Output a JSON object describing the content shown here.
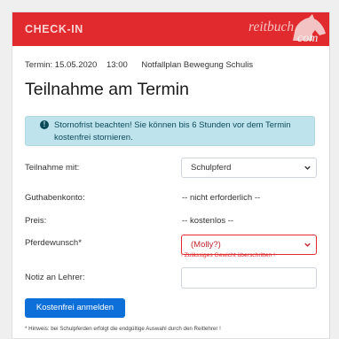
{
  "header": {
    "title": "CHECK-IN",
    "logo_text": "reitbuch",
    "logo_suffix": "com",
    "logo_icon": "horse-head-icon",
    "accent_color": "#e02a2e"
  },
  "appointment": {
    "date_text": "Termin: 15.05.2020",
    "time": "13:00",
    "name": "Notfallplan Bewegung Schulis"
  },
  "page_title": "Teilnahme am Termin",
  "alert": {
    "icon": "exclamation-circle-icon",
    "text": "Stornofrist beachten! Sie können bis 6 Stunden vor dem Termin kostenfrei stornieren."
  },
  "form": {
    "participation": {
      "label": "Teilnahme mit:",
      "selected": "Schulpferd"
    },
    "balance": {
      "label": "Guthabenkonto:",
      "value": "-- nicht erforderlich --"
    },
    "price": {
      "label": "Preis:",
      "value": "-- kostenlos --"
    },
    "horse_wish": {
      "label": "Pferdewunsch*",
      "selected": "(Molly?)",
      "error": "! Zulässiges Gewicht überschritten !",
      "error_color": "#e02a2e"
    },
    "note": {
      "label": "Notiz an Lehrer:",
      "value": ""
    }
  },
  "submit_label": "Kostenfrei anmelden",
  "footer_hint": "* Hinweis: bei Schulpferden erfolgt die endgültige Auswahl durch den Reitlehrer !"
}
